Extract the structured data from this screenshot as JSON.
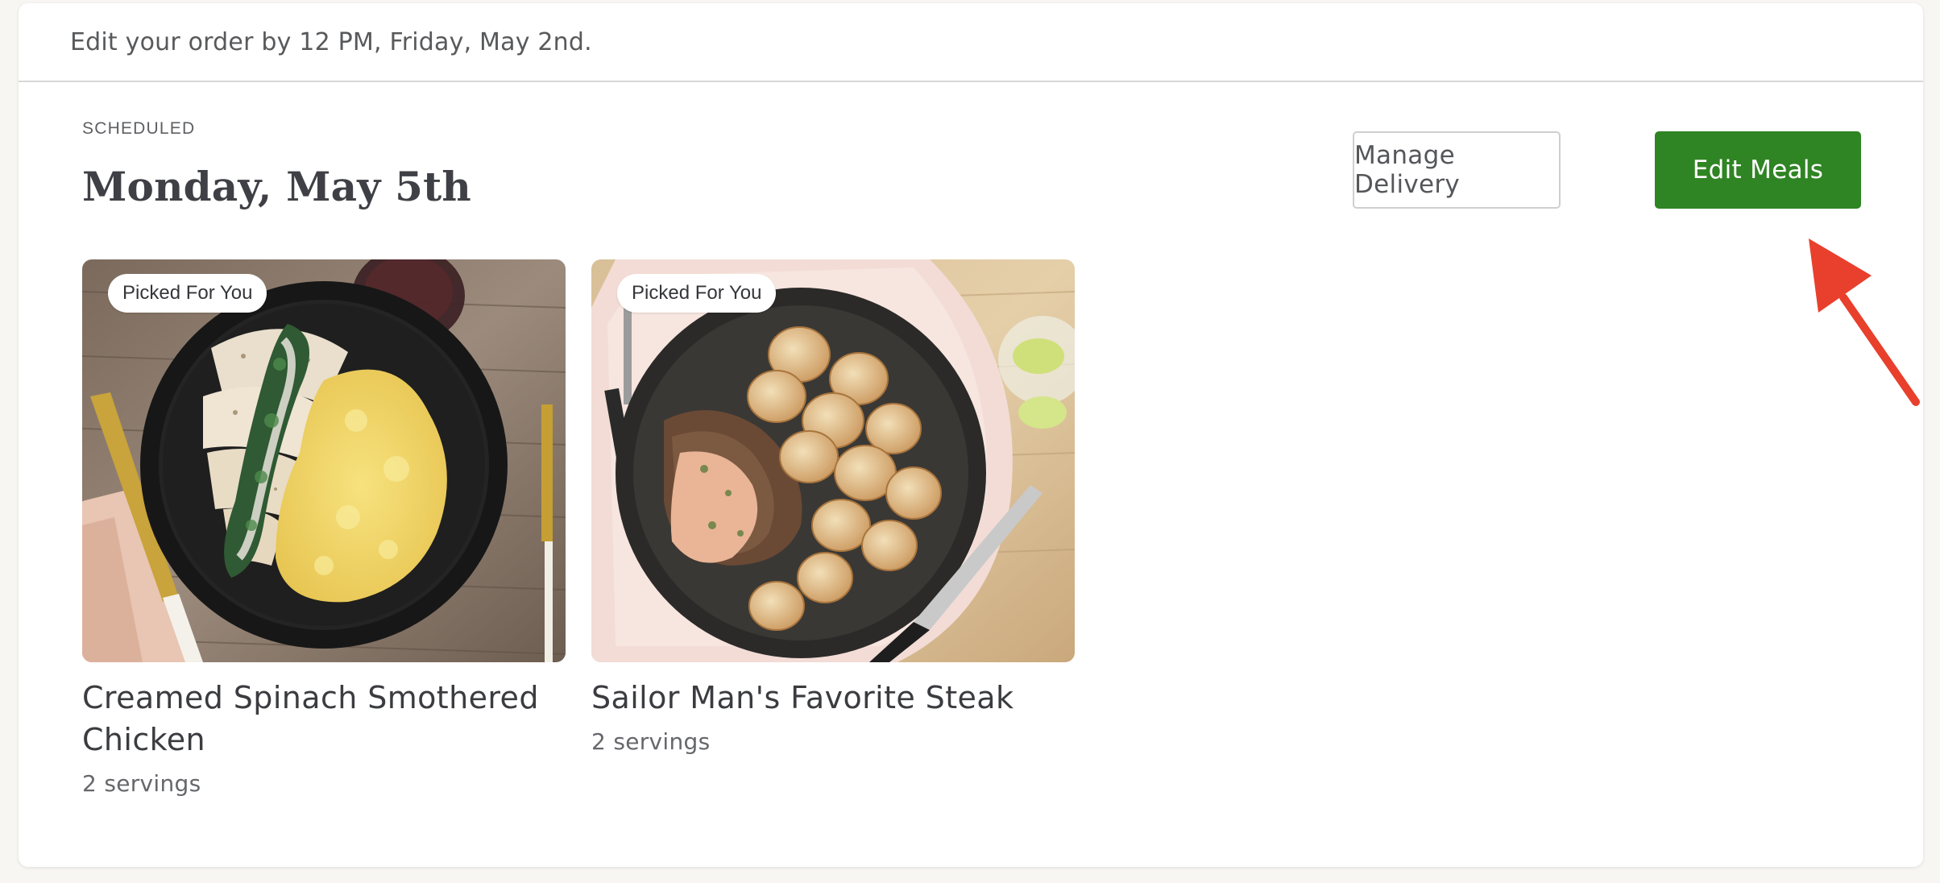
{
  "notice": {
    "text": "Edit your order by 12 PM, Friday, May 2nd."
  },
  "delivery": {
    "status": "SCHEDULED",
    "date": "Monday, May 5th"
  },
  "actions": {
    "manage_delivery_label": "Manage Delivery",
    "edit_meals_label": "Edit Meals"
  },
  "meals": [
    {
      "badge": "Picked For You",
      "name": "Creamed Spinach Smothered Chicken",
      "servings": "2 servings",
      "image_icon": "chicken-dish-image"
    },
    {
      "badge": "Picked For You",
      "name": "Sailor Man's Favorite Steak",
      "servings": "2 servings",
      "image_icon": "steak-dish-image"
    }
  ],
  "colors": {
    "primary_green": "#2f8423",
    "annotation_red": "#e8402c",
    "background": "#f8f6f3"
  }
}
